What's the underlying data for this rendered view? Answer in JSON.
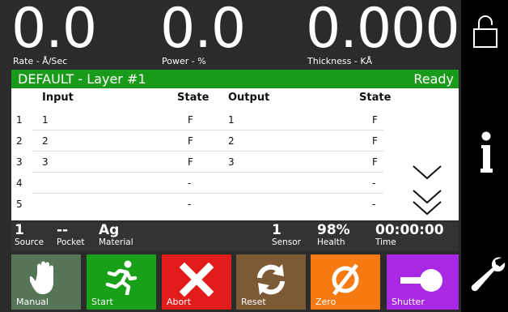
{
  "readouts": {
    "rate": {
      "value": "0.0",
      "label": "Rate - Å/Sec"
    },
    "power": {
      "value": "0.0",
      "label": "Power - %"
    },
    "thickness": {
      "value": "0.000",
      "label": "Thickness - KÅ"
    }
  },
  "status": {
    "layer": "DEFAULT - Layer #1",
    "state": "Ready"
  },
  "table": {
    "headers": {
      "input": "Input",
      "input_state": "State",
      "output": "Output",
      "output_state": "State"
    },
    "rows": [
      {
        "num": "1",
        "input": "1",
        "input_state": "F",
        "output": "1",
        "output_state": "F"
      },
      {
        "num": "2",
        "input": "2",
        "input_state": "F",
        "output": "2",
        "output_state": "F"
      },
      {
        "num": "3",
        "input": "3",
        "input_state": "F",
        "output": "3",
        "output_state": "F"
      },
      {
        "num": "4",
        "input": "",
        "input_state": "-",
        "output": "",
        "output_state": "-"
      },
      {
        "num": "5",
        "input": "",
        "input_state": "-",
        "output": "",
        "output_state": "-"
      }
    ]
  },
  "info": {
    "source": {
      "value": "1",
      "label": "Source"
    },
    "pocket": {
      "value": "--",
      "label": "Pocket"
    },
    "material": {
      "value": "Ag",
      "label": "Material"
    },
    "sensor": {
      "value": "1",
      "label": "Sensor"
    },
    "health": {
      "value": "98%",
      "label": "Health"
    },
    "time": {
      "value": "00:00:00",
      "label": "Time"
    }
  },
  "buttons": {
    "manual": "Manual",
    "start": "Start",
    "abort": "Abort",
    "reset": "Reset",
    "zero": "Zero",
    "shutter": "Shutter"
  },
  "icons": {
    "lock": "lock-open-icon",
    "info": "info-icon",
    "settings": "wrench-icon",
    "scroll_down": "chevron-down-icon",
    "page_down": "double-chevron-down-icon"
  },
  "colors": {
    "status_bar": "#1a9a1a",
    "manual": "#567456",
    "start": "#18a018",
    "abort": "#e21b1b",
    "reset": "#7d5a36",
    "zero": "#f47a11",
    "shutter": "#a928e4"
  }
}
